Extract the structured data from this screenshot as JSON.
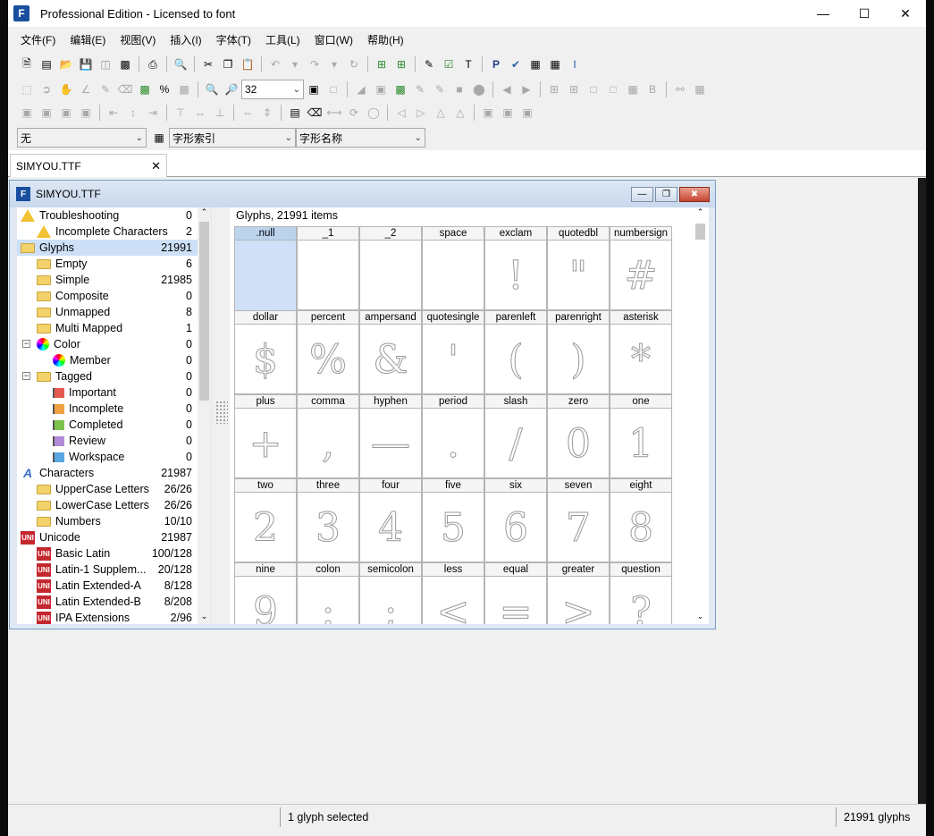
{
  "window": {
    "title": "Professional Edition - Licensed to font",
    "icon": "app-logo-icon"
  },
  "menu": [
    "文件(F)",
    "编辑(E)",
    "视图(V)",
    "插入(I)",
    "字体(T)",
    "工具(L)",
    "窗口(W)",
    "帮助(H)"
  ],
  "toolbar": {
    "zoom_value": "32",
    "combo1_value": "无",
    "combo2_value": "字形索引",
    "combo3_value": "字形名称"
  },
  "doc_tab": {
    "label": "SIMYOU.TTF"
  },
  "child_window": {
    "title": "SIMYOU.TTF"
  },
  "tree": [
    {
      "label": "Troubleshooting",
      "count": "0",
      "icon": "warning-icon",
      "level": 0
    },
    {
      "label": "Incomplete Characters",
      "count": "2",
      "icon": "warning-icon",
      "level": 1
    },
    {
      "label": "Glyphs",
      "count": "21991",
      "icon": "folder-icon",
      "level": 0,
      "selected": true
    },
    {
      "label": "Empty",
      "count": "6",
      "icon": "folder-icon",
      "level": 1
    },
    {
      "label": "Simple",
      "count": "21985",
      "icon": "folder-icon",
      "level": 1
    },
    {
      "label": "Composite",
      "count": "0",
      "icon": "folder-icon",
      "level": 1
    },
    {
      "label": "Unmapped",
      "count": "8",
      "icon": "folder-icon",
      "level": 1
    },
    {
      "label": "Multi Mapped",
      "count": "1",
      "icon": "folder-icon",
      "level": 1
    },
    {
      "label": "Color",
      "count": "0",
      "icon": "color-wheel-icon",
      "level": 1
    },
    {
      "label": "Member",
      "count": "0",
      "icon": "color-member-icon",
      "level": 2
    },
    {
      "label": "Tagged",
      "count": "0",
      "icon": "folder-icon",
      "level": 1
    },
    {
      "label": "Important",
      "count": "0",
      "icon": "flag-red-icon",
      "level": 2
    },
    {
      "label": "Incomplete",
      "count": "0",
      "icon": "flag-orange-icon",
      "level": 2
    },
    {
      "label": "Completed",
      "count": "0",
      "icon": "flag-green-icon",
      "level": 2
    },
    {
      "label": "Review",
      "count": "0",
      "icon": "flag-purple-icon",
      "level": 2
    },
    {
      "label": "Workspace",
      "count": "0",
      "icon": "flag-blue-icon",
      "level": 2
    },
    {
      "label": "Characters",
      "count": "21987",
      "icon": "font-a-icon",
      "level": 0
    },
    {
      "label": "UpperCase Letters",
      "count": "26/26",
      "icon": "folder-icon",
      "level": 1
    },
    {
      "label": "LowerCase Letters",
      "count": "26/26",
      "icon": "folder-icon",
      "level": 1
    },
    {
      "label": "Numbers",
      "count": "10/10",
      "icon": "folder-icon",
      "level": 1
    },
    {
      "label": "Unicode",
      "count": "21987",
      "icon": "unicode-icon",
      "level": 0
    },
    {
      "label": "Basic Latin",
      "count": "100/128",
      "icon": "unicode-icon",
      "level": 1
    },
    {
      "label": "Latin-1 Supplem...",
      "count": "20/128",
      "icon": "unicode-icon",
      "level": 1
    },
    {
      "label": "Latin Extended-A",
      "count": "8/128",
      "icon": "unicode-icon",
      "level": 1
    },
    {
      "label": "Latin Extended-B",
      "count": "8/208",
      "icon": "unicode-icon",
      "level": 1
    },
    {
      "label": "IPA Extensions",
      "count": "2/96",
      "icon": "unicode-icon",
      "level": 1
    }
  ],
  "glyph_pane": {
    "header": "Glyphs, 21991 items",
    "glyphs": [
      {
        "name": ".null",
        "char": "",
        "selected": true
      },
      {
        "name": "_1",
        "char": ""
      },
      {
        "name": "_2",
        "char": ""
      },
      {
        "name": "space",
        "char": ""
      },
      {
        "name": "exclam",
        "char": "!"
      },
      {
        "name": "quotedbl",
        "char": "\""
      },
      {
        "name": "numbersign",
        "char": "#"
      },
      {
        "name": "dollar",
        "char": "$"
      },
      {
        "name": "percent",
        "char": "%"
      },
      {
        "name": "ampersand",
        "char": "&"
      },
      {
        "name": "quotesingle",
        "char": "'"
      },
      {
        "name": "parenleft",
        "char": "("
      },
      {
        "name": "parenright",
        "char": ")"
      },
      {
        "name": "asterisk",
        "char": "*"
      },
      {
        "name": "plus",
        "char": "+"
      },
      {
        "name": "comma",
        "char": ","
      },
      {
        "name": "hyphen",
        "char": "—"
      },
      {
        "name": "period",
        "char": "."
      },
      {
        "name": "slash",
        "char": "/"
      },
      {
        "name": "zero",
        "char": "0"
      },
      {
        "name": "one",
        "char": "1"
      },
      {
        "name": "two",
        "char": "2"
      },
      {
        "name": "three",
        "char": "3"
      },
      {
        "name": "four",
        "char": "4"
      },
      {
        "name": "five",
        "char": "5"
      },
      {
        "name": "six",
        "char": "6"
      },
      {
        "name": "seven",
        "char": "7"
      },
      {
        "name": "eight",
        "char": "8"
      },
      {
        "name": "nine",
        "char": "9"
      },
      {
        "name": "colon",
        "char": ":"
      },
      {
        "name": "semicolon",
        "char": ";"
      },
      {
        "name": "less",
        "char": "<"
      },
      {
        "name": "equal",
        "char": "="
      },
      {
        "name": "greater",
        "char": ">"
      },
      {
        "name": "question",
        "char": "?"
      }
    ]
  },
  "status": {
    "message": "1 glyph selected",
    "count": "21991 glyphs"
  }
}
